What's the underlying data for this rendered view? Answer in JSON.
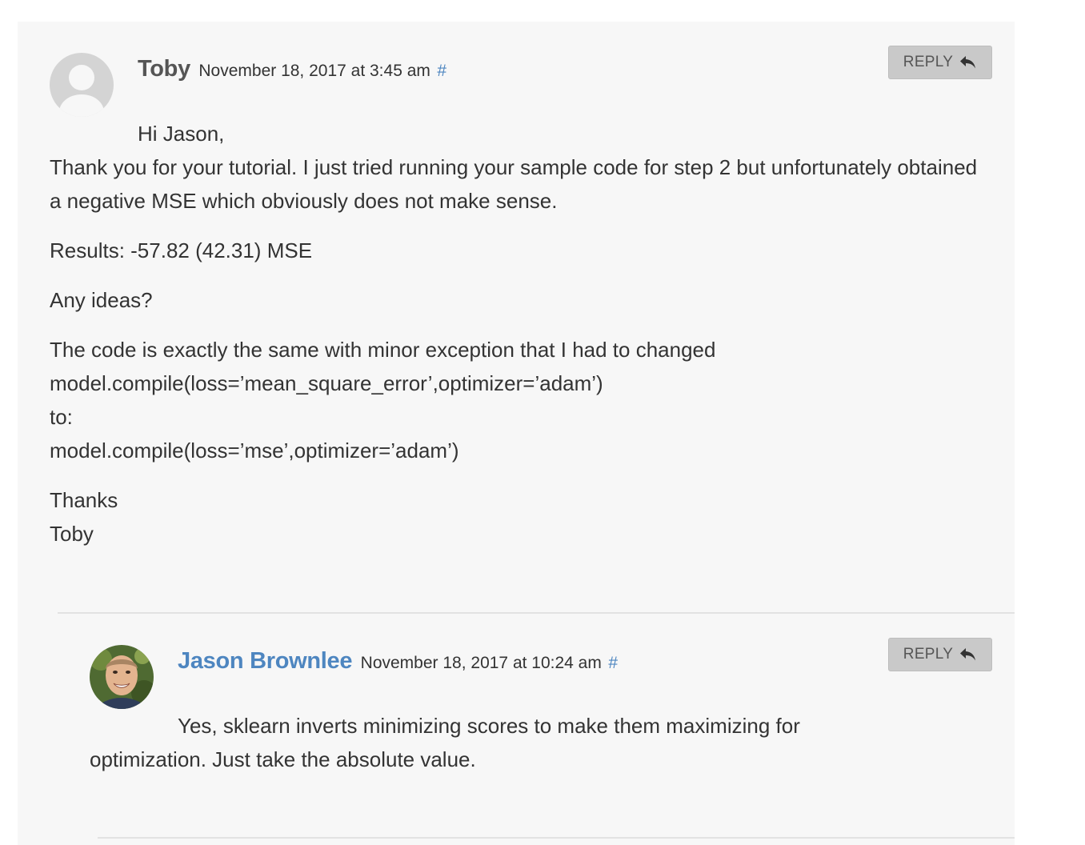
{
  "comments": [
    {
      "author": "Toby",
      "date": "November 18, 2017 at 3:45 am",
      "permalink": "#",
      "reply_label": "REPLY",
      "avatar": "default-avatar-icon",
      "paragraphs": [
        {
          "lines": [
            "Hi Jason,",
            "Thank you for your tutorial. I just tried running your sample code for step 2 but unfortunately obtained a negative MSE which obviously does not make sense."
          ]
        },
        {
          "lines": [
            "Results: -57.82 (42.31) MSE"
          ]
        },
        {
          "lines": [
            "Any ideas?"
          ]
        },
        {
          "lines": [
            "The code is exactly the same with minor exception that I had to changed",
            "model.compile(loss=’mean_square_error’,optimizer=’adam’)",
            "to:",
            "model.compile(loss=’mse’,optimizer=’adam’)"
          ]
        },
        {
          "lines": [
            "Thanks",
            "Toby"
          ]
        }
      ]
    },
    {
      "author": "Jason Brownlee",
      "date": "November 18, 2017 at 10:24 am",
      "permalink": "#",
      "reply_label": "REPLY",
      "avatar": "user-photo-avatar",
      "paragraphs": [
        {
          "lines": [
            "Yes, sklearn inverts minimizing scores to make them maximizing for optimization. Just take the absolute value."
          ]
        }
      ]
    }
  ],
  "colors": {
    "link": "#4e86c0",
    "panel_bg": "#f7f7f7",
    "reply_bg": "#c9c9c9"
  }
}
